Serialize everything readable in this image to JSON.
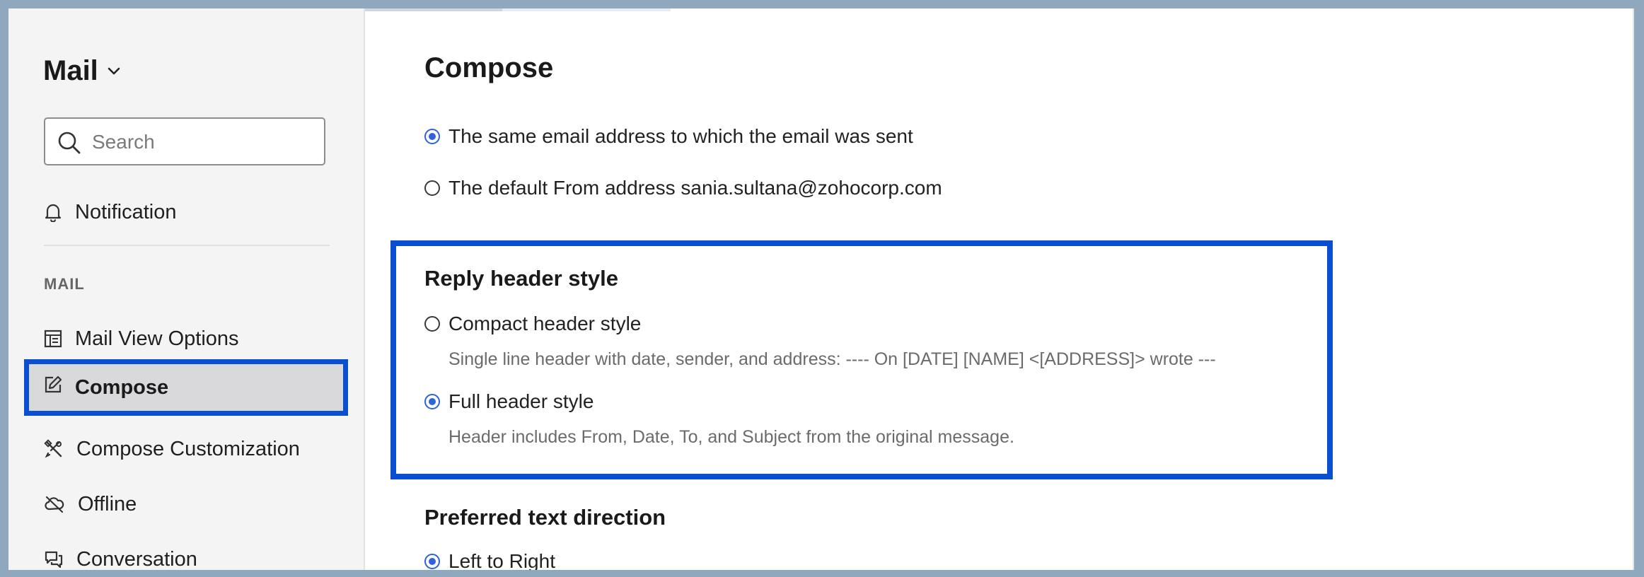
{
  "sidebar": {
    "app_title": "Mail",
    "search_placeholder": "Search",
    "notification_label": "Notification",
    "section_label": "MAIL",
    "items": [
      {
        "label": "Mail View Options",
        "icon": "layout-icon"
      },
      {
        "label": "Compose",
        "icon": "edit-icon",
        "active": true
      },
      {
        "label": "Compose Customization",
        "icon": "tools-icon"
      },
      {
        "label": "Offline",
        "icon": "cloud-off-icon"
      },
      {
        "label": "Conversation",
        "icon": "chat-icon"
      }
    ]
  },
  "main": {
    "title": "Compose",
    "from_options": [
      {
        "label": "The same email address to which the email was sent",
        "checked": true
      },
      {
        "label": "The default From address sania.sultana@zohocorp.com",
        "checked": false
      }
    ],
    "reply_header": {
      "title": "Reply header style",
      "options": [
        {
          "label": "Compact header style",
          "description": "Single line header with date, sender, and address: ---- On [DATE] [NAME] <[ADDRESS]> wrote ---",
          "checked": false
        },
        {
          "label": "Full header style",
          "description": "Header includes From, Date, To, and Subject from the original message.",
          "checked": true
        }
      ]
    },
    "text_direction": {
      "title": "Preferred text direction",
      "options": [
        {
          "label": "Left to Right",
          "checked": true
        }
      ]
    }
  },
  "colors": {
    "highlight": "#0a4fd1",
    "radio_checked": "#2f63d6",
    "sidebar_bg": "#f4f4f4",
    "active_bg": "#d9d9dc",
    "window_border": "#8fa8bd"
  }
}
